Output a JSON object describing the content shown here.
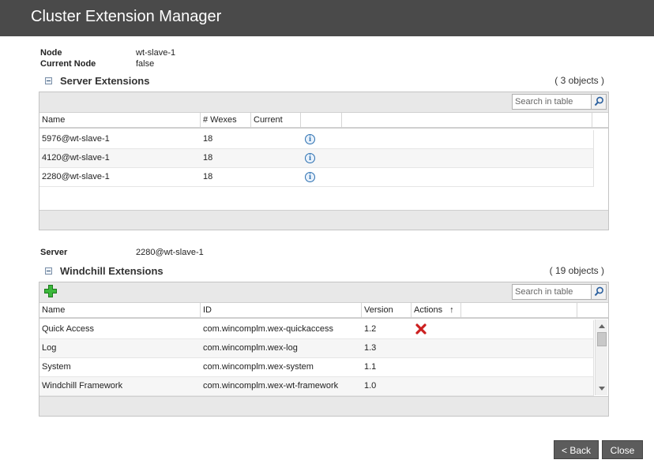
{
  "window": {
    "title": "Cluster Extension Manager"
  },
  "node_info": {
    "node_label": "Node",
    "node_value": "wt-slave-1",
    "current_node_label": "Current Node",
    "current_node_value": "false"
  },
  "server_extensions": {
    "title": "Server Extensions",
    "count": "( 3 objects )",
    "search_placeholder": "Search in table",
    "columns": [
      "Name",
      "# Wexes",
      "Current"
    ],
    "rows": [
      {
        "name": "5976@wt-slave-1",
        "wexes": "18",
        "current": "",
        "action_icon": "info-icon"
      },
      {
        "name": "4120@wt-slave-1",
        "wexes": "18",
        "current": "",
        "action_icon": "info-icon"
      },
      {
        "name": "2280@wt-slave-1",
        "wexes": "18",
        "current": "",
        "action_icon": "info-icon"
      }
    ]
  },
  "server_info": {
    "server_label": "Server",
    "server_value": "2280@wt-slave-1"
  },
  "windchill_extensions": {
    "title": "Windchill Extensions",
    "count": "( 19 objects )",
    "search_placeholder": "Search in table",
    "columns": [
      "Name",
      "ID",
      "Version",
      "Actions"
    ],
    "sort_indicator": "↑",
    "rows": [
      {
        "name": "Quick Access",
        "id": "com.wincomplm.wex-quickaccess",
        "version": "1.2",
        "action": "delete-icon"
      },
      {
        "name": "Log",
        "id": "com.wincomplm.wex-log",
        "version": "1.3",
        "action": ""
      },
      {
        "name": "System",
        "id": "com.wincomplm.wex-system",
        "version": "1.1",
        "action": ""
      },
      {
        "name": "Windchill Framework",
        "id": "com.wincomplm.wex-wt-framework",
        "version": "1.0",
        "action": ""
      }
    ]
  },
  "buttons": {
    "back": "< Back",
    "close": "Close"
  },
  "colors": {
    "titlebar": "#4a4a4a",
    "button": "#5c5c5c",
    "info": "#2a6fb0",
    "add": "#2ea02e",
    "delete": "#cc2020"
  }
}
